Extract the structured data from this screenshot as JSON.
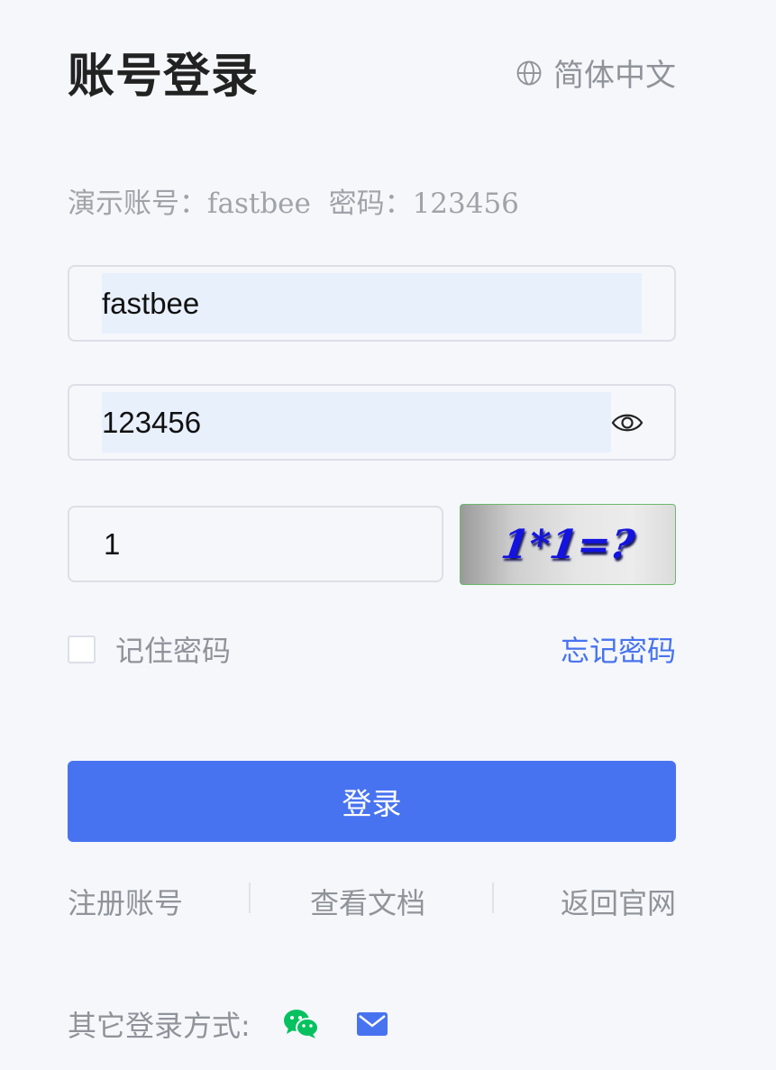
{
  "header": {
    "title": "账号登录",
    "language_label": "简体中文",
    "language_icon": "globe-icon"
  },
  "demo_hint": "演示账号：fastbee  密码：123456",
  "form": {
    "username_value": "fastbee",
    "password_value": "123456",
    "password_icon": "eye-icon",
    "code_value": "1",
    "captcha_text": "1*1=?",
    "remember_label": "记住密码",
    "remember_checked": false,
    "forgot_label": "忘记密码",
    "login_label": "登录"
  },
  "links": {
    "register": "注册账号",
    "docs": "查看文档",
    "home": "返回官网"
  },
  "other_login": {
    "label": "其它登录方式:",
    "icons": [
      "wechat-icon",
      "mail-icon"
    ]
  },
  "colors": {
    "primary": "#4873f0",
    "background": "#f5f7fb",
    "muted_text": "#909399",
    "autofill": "#e8f0fc",
    "wechat": "#07c160"
  }
}
